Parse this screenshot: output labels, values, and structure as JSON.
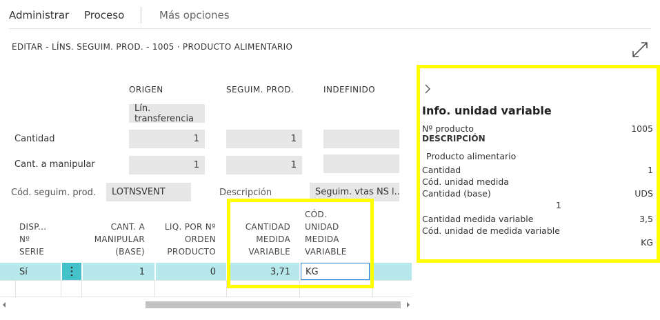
{
  "menu": {
    "admin": "Administrar",
    "proceso": "Proceso",
    "mas": "Más opciones"
  },
  "page": {
    "title": "EDITAR - LÍNS. SEGUIM. PROD. - 1005 · PRODUCTO ALIMENTARIO"
  },
  "summary": {
    "col_origen": "ORIGEN",
    "col_seguim": "SEGUIM. PROD.",
    "col_indefinido": "INDEFINIDO",
    "origen_value": "Lín. transferencia",
    "cantidad_label": "Cantidad",
    "cantidad_origen": "1",
    "cantidad_seguim": "1",
    "cant_manip_label": "Cant. a manipular",
    "cant_manip_origen": "1",
    "cant_manip_seguim": "1",
    "cod_label": "Cód. seguim. prod.",
    "cod_value": "LOTNSVENT",
    "desc_label": "Descripción",
    "desc_value": "Seguim. vtas NS l..."
  },
  "grid": {
    "h_disp": [
      "DISP...",
      "Nº",
      "SERIE"
    ],
    "h_cant": [
      "CANT. A",
      "MANIPULAR",
      "(BASE)"
    ],
    "h_liq": [
      "LIQ. POR Nº",
      "ORDEN",
      "PRODUCTO"
    ],
    "h_cmv": [
      "CANTIDAD",
      "MEDIDA",
      "VARIABLE"
    ],
    "h_cod": [
      "CÓD.",
      "UNIDAD",
      "MEDIDA",
      "VARIABLE"
    ],
    "row": {
      "disp": "Sí",
      "cant": "1",
      "liq": "0",
      "cmv": "3,71",
      "cod": "KG"
    }
  },
  "factbox": {
    "title": "Info. unidad variable",
    "nproducto_label": "Nº producto",
    "nproducto_value": "1005",
    "descripcion_label": "DESCRIPCIÓN",
    "descripcion_value": "Producto alimentario",
    "cantidad_label": "Cantidad",
    "cantidad_value": "1",
    "cod_unidad_label": "Cód. unidad medida",
    "cantidad_base_label": "Cantidad (base)",
    "cantidad_base_unit": "UDS",
    "cantidad_base_value": "1",
    "cmv_label": "Cantidad medida variable",
    "cmv_value": "3,5",
    "cod_umv_label": "Cód. unidad de medida variable",
    "cod_umv_value": "KG"
  },
  "colors": {
    "highlight": "#ffff00",
    "row_selected": "#b6e8ec",
    "field_bg": "#e6e6e6"
  }
}
